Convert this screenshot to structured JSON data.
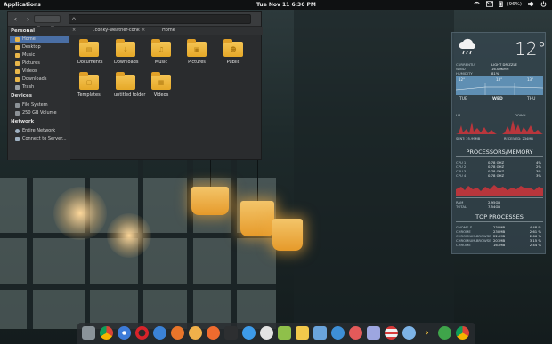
{
  "top_panel": {
    "applications_label": "Applications",
    "clock": "Tue Nov 11  6:36 PM",
    "battery": "(96%)"
  },
  "file_manager": {
    "tabs": [
      ".conky-weather-conk",
      "Home"
    ],
    "sidebar": {
      "personal_header": "Personal",
      "personal_items": [
        "Home",
        "Desktop",
        "Music",
        "Pictures",
        "Videos",
        "Downloads",
        "Trash"
      ],
      "devices_header": "Devices",
      "devices_items": [
        "File System",
        "250 GB Volume"
      ],
      "network_header": "Network",
      "network_items": [
        "Entire Network",
        "Connect to Server..."
      ]
    },
    "folders": [
      "Documents",
      "Downloads",
      "Music",
      "Pictures",
      "Public",
      "Templates",
      "untitled folder",
      "Videos"
    ]
  },
  "conky": {
    "temperature": "12°",
    "weather_rows": [
      {
        "label": "CURRENTLY",
        "value": "LIGHT DRIZZLE"
      },
      {
        "label": "WIND",
        "value": "16.09KMH"
      },
      {
        "label": "HUMIDITY",
        "value": "81%"
      }
    ],
    "forecast_temps": [
      "12°",
      "13°",
      "13°"
    ],
    "forecast_days": [
      "TUE",
      "WED",
      "THU"
    ],
    "net": {
      "up": "UP",
      "down": "DOWN",
      "sent": "SENT: 25.99MB",
      "received": "RECEIVED: 234MB"
    },
    "processors_heading": "PROCESSORS/MEMORY",
    "cpus": [
      {
        "name": "CPU 1",
        "freq": "0.78 GHZ",
        "pct": "4%"
      },
      {
        "name": "CPU 2",
        "freq": "0.78 GHZ",
        "pct": "2%"
      },
      {
        "name": "CPU 3",
        "freq": "0.78 GHZ",
        "pct": "3%"
      },
      {
        "name": "CPU 4",
        "freq": "0.78 GHZ",
        "pct": "3%"
      }
    ],
    "ram": {
      "label": "RAM",
      "value": "2.95GB"
    },
    "total": {
      "label": "TOTAL",
      "value": "7.54GB"
    },
    "top_heading": "TOP PROCESSES",
    "processes": [
      {
        "name": "GNOME-S",
        "mem": "230MB",
        "pct": "4.48 %"
      },
      {
        "name": "CHROME",
        "mem": "230MB",
        "pct": "2.61 %"
      },
      {
        "name": "CHROMIUM-BROWSE",
        "mem": "224MB",
        "pct": "2.66 %"
      },
      {
        "name": "CHROMIUM-BROWSE",
        "mem": "201MB",
        "pct": "3.15 %"
      },
      {
        "name": "CHROME",
        "mem": "163MB",
        "pct": "2.44 %"
      }
    ]
  },
  "dock": {
    "icons": [
      "files-icon",
      "chrome-icon",
      "chromium-icon",
      "opera-icon",
      "messenger-icon",
      "firefox-icon",
      "hedgehog-icon",
      "twitter-icon",
      "terminal-icon",
      "yen-icon",
      "notes-icon",
      "image-viewer-icon",
      "sticky-icon",
      "calculator-icon",
      "music-icon",
      "settings-icon",
      "documents-icon",
      "flag-icon",
      "browser-icon",
      "chevron-icon",
      "chat-icon",
      "chrome-2-icon"
    ]
  },
  "colors": {
    "accent": "#4a6fa5",
    "folder": "#f0b83c",
    "panel": "#0f1112"
  }
}
